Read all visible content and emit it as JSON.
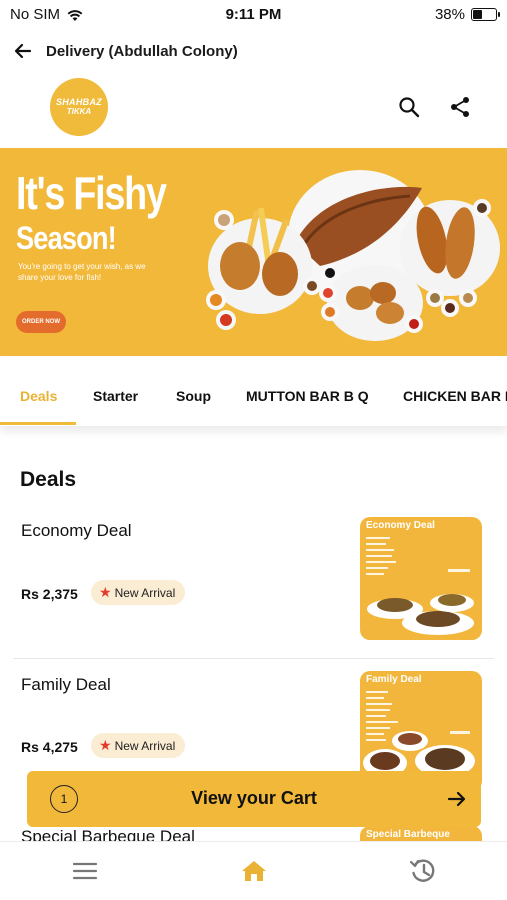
{
  "status": {
    "carrier": "No SIM",
    "time": "9:11 PM",
    "battery": "38%"
  },
  "header": {
    "title": "Delivery (Abdullah Colony)",
    "back_icon": "arrow-left-icon"
  },
  "brand": {
    "logo_line1": "SHAHBAZ",
    "logo_line2": "TIKKA",
    "search_icon": "search-icon",
    "share_icon": "share-icon"
  },
  "banner": {
    "headline": "It's Fishy",
    "headline2": "Season!",
    "tagline": "You're going to get your wish, as we share your love for fish!",
    "cta": "ORDER NOW"
  },
  "categories": [
    "Deals",
    "Starter",
    "Soup",
    "MUTTON BAR B Q",
    "CHICKEN BAR B"
  ],
  "section": {
    "title": "Deals"
  },
  "items": [
    {
      "name": "Economy Deal",
      "price": "Rs 2,375",
      "badge": "New Arrival",
      "thumb_title": "Economy Deal"
    },
    {
      "name": "Family Deal",
      "price": "Rs 4,275",
      "badge": "New Arrival",
      "thumb_title": "Family Deal"
    },
    {
      "name": "Special Barbeque Deal",
      "thumb_title": "Special Barbeque"
    }
  ],
  "cart": {
    "count": "1",
    "label": "View your Cart"
  },
  "nav": {
    "menu_icon": "menu-icon",
    "home_icon": "home-icon",
    "history_icon": "history-icon"
  },
  "colors": {
    "accent": "#f2b83a",
    "active_tab": "#eab233",
    "badge_bg": "#fbecd4",
    "star": "#e43a2c"
  }
}
